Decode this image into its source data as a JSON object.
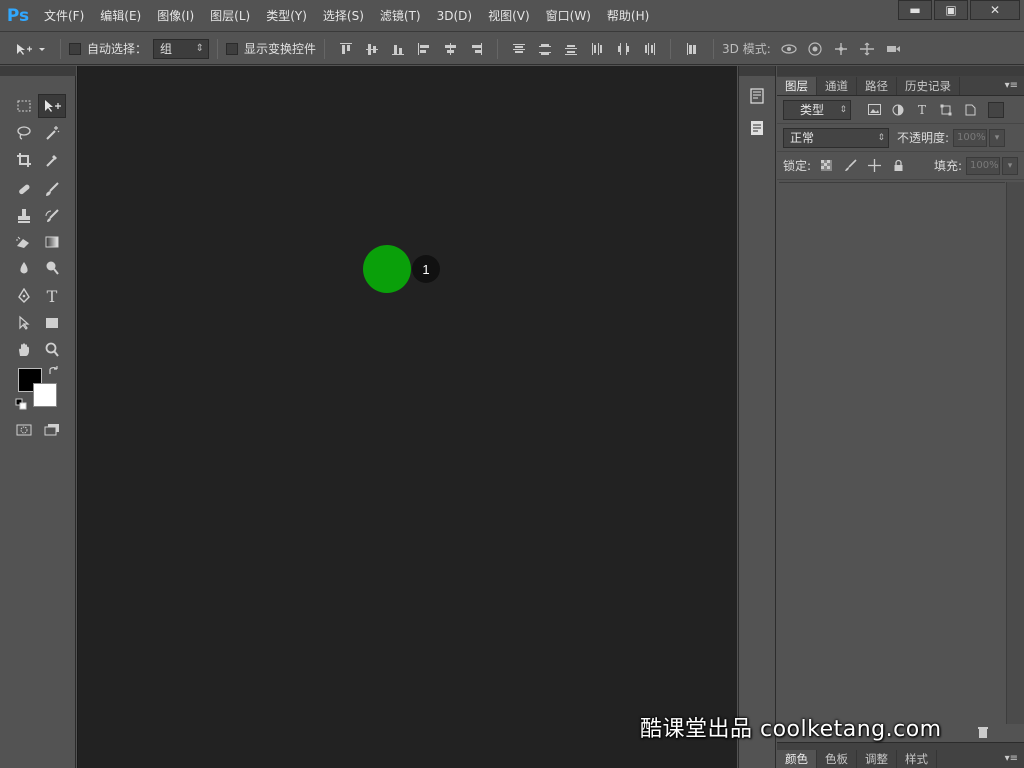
{
  "app": {
    "logo": "Ps"
  },
  "menu": [
    {
      "label": "文件(F)"
    },
    {
      "label": "编辑(E)"
    },
    {
      "label": "图像(I)"
    },
    {
      "label": "图层(L)"
    },
    {
      "label": "类型(Y)"
    },
    {
      "label": "选择(S)"
    },
    {
      "label": "滤镜(T)"
    },
    {
      "label": "3D(D)"
    },
    {
      "label": "视图(V)"
    },
    {
      "label": "窗口(W)"
    },
    {
      "label": "帮助(H)"
    }
  ],
  "window_controls": {
    "minimize": "▬",
    "maximize": "▣",
    "close": "✕"
  },
  "options": {
    "auto_select_label": "自动选择：",
    "auto_select_value": "组",
    "show_transform_label": "显示变换控件",
    "mode_3d_label": "3D 模式:"
  },
  "canvas": {
    "badge_number": "1",
    "marker_color": "#0aa00a",
    "background": "#222222"
  },
  "panels": {
    "tabs": [
      "图层",
      "通道",
      "路径",
      "历史记录"
    ],
    "active_tab": "图层",
    "filter_kind": "类型",
    "blend_mode": "正常",
    "opacity_label": "不透明度:",
    "opacity_value": "100%",
    "lock_label": "锁定:",
    "fill_label": "填充:",
    "fill_value": "100%",
    "bottom_tabs": [
      "颜色",
      "色板",
      "调整",
      "样式"
    ],
    "bottom_active_tab": "颜色"
  },
  "colors": {
    "foreground": "#000000",
    "background": "#ffffff",
    "accent": "#31a8ff"
  },
  "watermark": "酷课堂出品 coolketang.com"
}
